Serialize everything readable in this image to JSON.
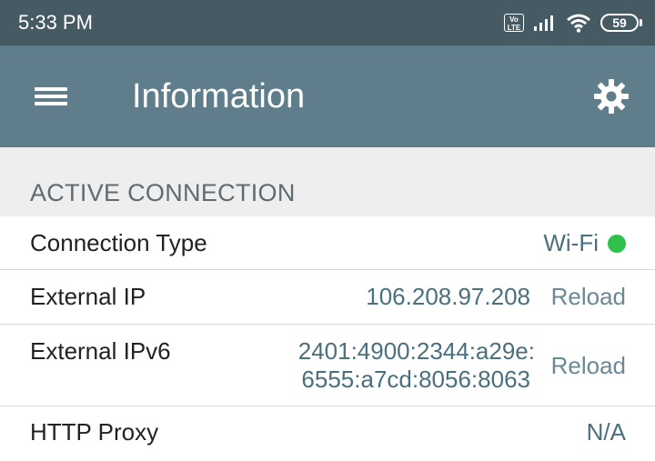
{
  "status_bar": {
    "time": "5:33 PM",
    "volte_label": "Vo\nLTE",
    "battery_level": "59"
  },
  "app_bar": {
    "title": "Information",
    "menu_icon": "hamburger-menu-icon",
    "settings_icon": "gear-icon"
  },
  "section": {
    "title": "ACTIVE CONNECTION"
  },
  "rows": [
    {
      "label": "Connection Type",
      "value": "Wi-Fi",
      "status_color": "#2ec24a"
    },
    {
      "label": "External IP",
      "value": "106.208.97.208",
      "action": "Reload"
    },
    {
      "label": "External IPv6",
      "value_line1": "2401:4900:2344:a29e:",
      "value_line2": "6555:a7cd:8056:8063",
      "action": "Reload"
    },
    {
      "label": "HTTP Proxy",
      "value": "N/A"
    }
  ],
  "colors": {
    "status_bar": "#465a64",
    "app_bar": "#5f7d8b",
    "value_text": "#4a6f7e",
    "connected_indicator": "#2ec24a"
  }
}
